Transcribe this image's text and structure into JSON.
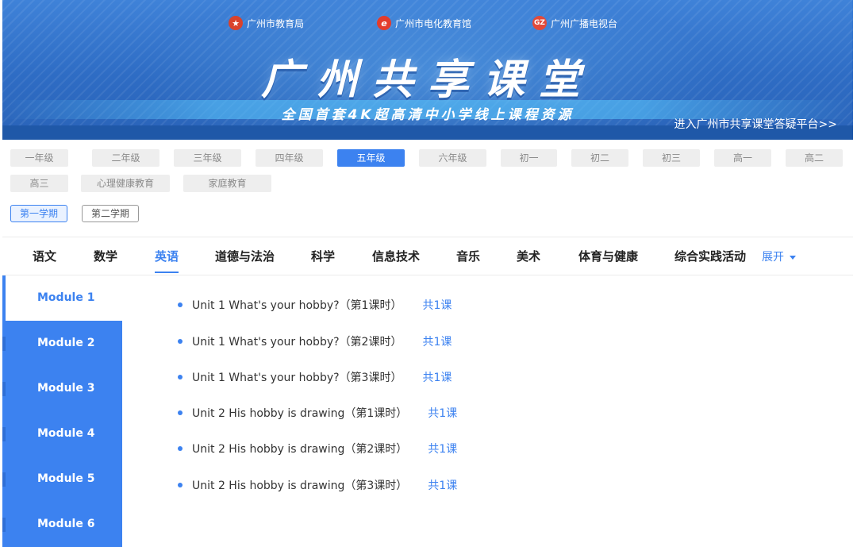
{
  "banner": {
    "logos": [
      {
        "icon": "education-bureau-emblem-icon",
        "label": "广州市教育局"
      },
      {
        "icon": "e-logo-icon",
        "label": "广州市电化教育馆"
      },
      {
        "icon": "gz-broadcast-logo-icon",
        "label": "广州广播电视台"
      }
    ],
    "title": "广州共享课堂",
    "subtitle": "全国首套4K超高清中小学线上课程资源",
    "qa_link": "进入广州市共享课堂答疑平台>>"
  },
  "grades": [
    "一年级",
    "二年级",
    "三年级",
    "四年级",
    "五年级",
    "六年级",
    "初一",
    "初二",
    "初三",
    "高一",
    "高二",
    "高三",
    "心理健康教育",
    "家庭教育"
  ],
  "active_grade": "五年级",
  "semesters": [
    "第一学期",
    "第二学期"
  ],
  "active_semester": "第一学期",
  "subjects": [
    "语文",
    "数学",
    "英语",
    "道德与法治",
    "科学",
    "信息技术",
    "音乐",
    "美术",
    "体育与健康",
    "综合实践活动"
  ],
  "active_subject": "英语",
  "expand_label": "展开",
  "modules": [
    "Module 1",
    "Module 2",
    "Module 3",
    "Module 4",
    "Module 5",
    "Module 6"
  ],
  "active_module": "Module 1",
  "lessons": [
    {
      "title": "Unit 1 What's your hobby?（第1课时）",
      "count": "共1课"
    },
    {
      "title": "Unit 1 What's your hobby?（第2课时）",
      "count": "共1课"
    },
    {
      "title": "Unit 1 What's your hobby?（第3课时）",
      "count": "共1课"
    },
    {
      "title": "Unit 2 His hobby is drawing（第1课时）",
      "count": "共1课"
    },
    {
      "title": "Unit 2 His hobby is drawing（第2课时）",
      "count": "共1课"
    },
    {
      "title": "Unit 2 His hobby is drawing（第3课时）",
      "count": "共1课"
    }
  ],
  "colors": {
    "accent": "#3c82f0",
    "banner": "#2e6cc4"
  }
}
